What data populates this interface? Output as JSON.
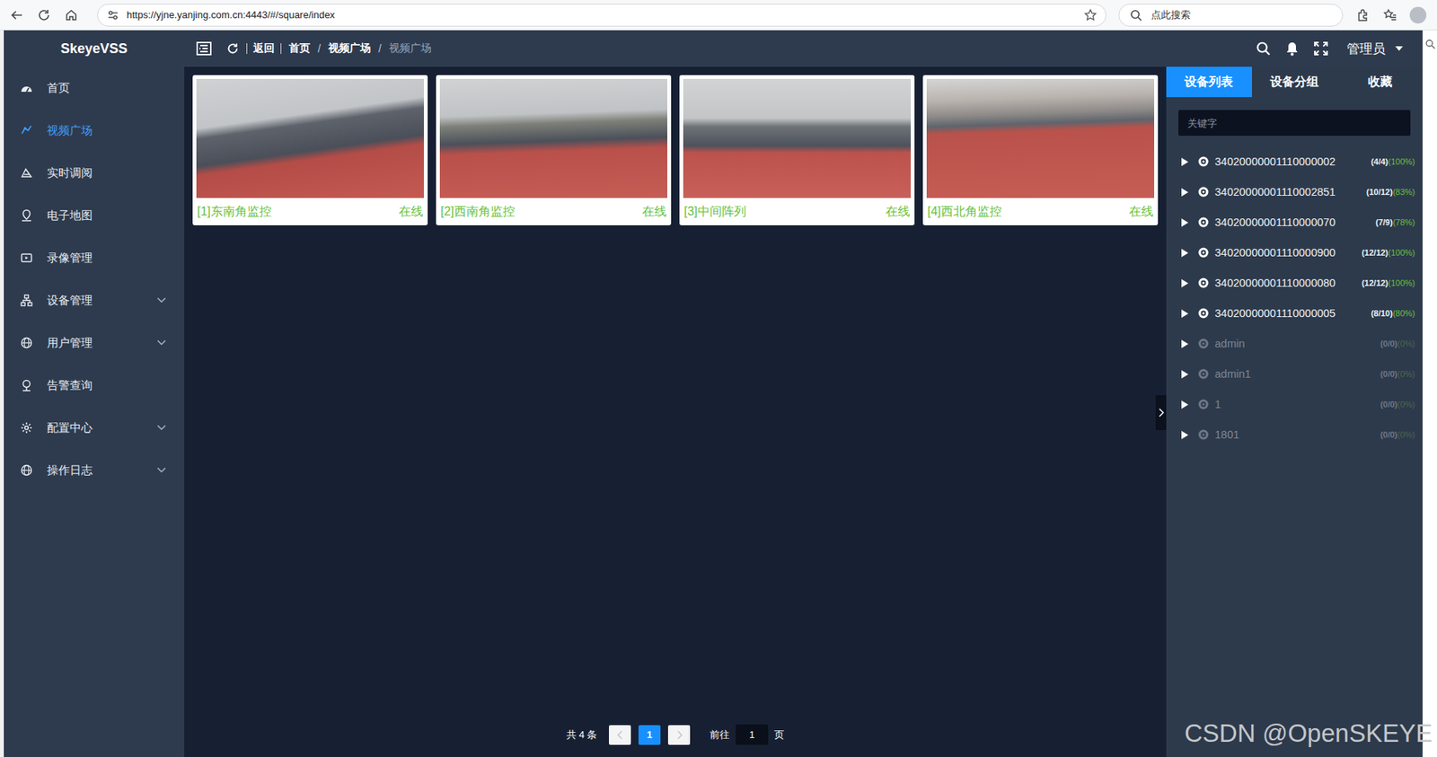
{
  "browser": {
    "url": "https://yjne.yanjing.com.cn:4443/#/square/index",
    "search_placeholder": "点此搜索"
  },
  "logo": "SkeyeVSS",
  "sidebar": {
    "items": [
      {
        "label": "首页",
        "selected": false,
        "expandable": false
      },
      {
        "label": "视频广场",
        "selected": true,
        "expandable": false
      },
      {
        "label": "实时调阅",
        "selected": false,
        "expandable": false
      },
      {
        "label": "电子地图",
        "selected": false,
        "expandable": false
      },
      {
        "label": "录像管理",
        "selected": false,
        "expandable": false
      },
      {
        "label": "设备管理",
        "selected": false,
        "expandable": true
      },
      {
        "label": "用户管理",
        "selected": false,
        "expandable": true
      },
      {
        "label": "告警查询",
        "selected": false,
        "expandable": false
      },
      {
        "label": "配置中心",
        "selected": false,
        "expandable": true
      },
      {
        "label": "操作日志",
        "selected": false,
        "expandable": true
      }
    ]
  },
  "header": {
    "back": "返回",
    "breadcrumb": [
      {
        "label": "首页",
        "current": false
      },
      {
        "label": "视频广场",
        "current": false
      },
      {
        "label": "视频广场",
        "current": true
      }
    ],
    "separator": "/",
    "user": "管理员"
  },
  "cards": [
    {
      "title": "[1]东南角监控",
      "status": "在线"
    },
    {
      "title": "[2]西南角监控",
      "status": "在线"
    },
    {
      "title": "[3]中间阵列",
      "status": "在线"
    },
    {
      "title": "[4]西北角监控",
      "status": "在线"
    }
  ],
  "pagination": {
    "total": "共 4 条",
    "prev_disabled": true,
    "next_disabled": true,
    "pages": [
      {
        "label": "1",
        "selected": true
      }
    ],
    "goto": "前往",
    "goto_value": "1",
    "page_unit": "页"
  },
  "right_panel": {
    "tabs": [
      {
        "label": "设备列表",
        "selected": true
      },
      {
        "label": "设备分组",
        "selected": false
      },
      {
        "label": "收藏",
        "selected": false
      }
    ],
    "search_placeholder": "关键字",
    "devices": [
      {
        "name": "34020000001110000002",
        "count": "(4/4)",
        "percent": "(100%)",
        "online": true
      },
      {
        "name": "34020000001110002851",
        "count": "(10/12)",
        "percent": "(83%)",
        "online": true
      },
      {
        "name": "34020000001110000070",
        "count": "(7/9)",
        "percent": "(78%)",
        "online": true
      },
      {
        "name": "34020000001110000900",
        "count": "(12/12)",
        "percent": "(100%)",
        "online": true
      },
      {
        "name": "34020000001110000080",
        "count": "(12/12)",
        "percent": "(100%)",
        "online": true
      },
      {
        "name": "34020000001110000005",
        "count": "(8/10)",
        "percent": "(80%)",
        "online": true
      },
      {
        "name": "admin",
        "count": "(0/0)",
        "percent": "(0%)",
        "online": false
      },
      {
        "name": "admin1",
        "count": "(0/0)",
        "percent": "(0%)",
        "online": false
      },
      {
        "name": "1",
        "count": "(0/0)",
        "percent": "(0%)",
        "online": false
      },
      {
        "name": "1801",
        "count": "(0/0)",
        "percent": "(0%)",
        "online": false
      }
    ]
  },
  "watermark": "CSDN @OpenSKEYE"
}
